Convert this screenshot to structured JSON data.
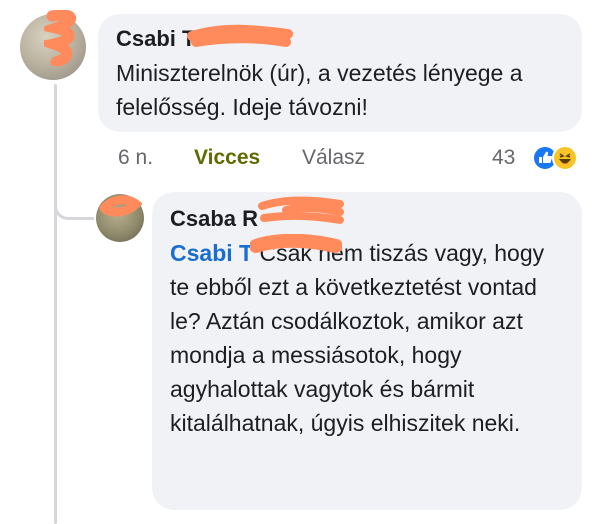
{
  "comment": {
    "author": "Csabi T",
    "text": "Miniszterelnök (úr), a vezetés lényege a felelősség. Ideje távozni!",
    "time": "6 n.",
    "reaction_label": "Vicces",
    "reply_label": "Válasz",
    "reaction_count": "43",
    "reaction_icons": [
      "like-icon",
      "haha-icon"
    ]
  },
  "reply": {
    "author": "Csaba R",
    "mention": "Csabi T",
    "text": "Csak nem tiszás vagy, hogy te ebből ezt a következtetést vontad le? Aztán csodálkoztok, amikor azt mondja a messiásotok, hogy agyhalottak vagytok és bármit kitalálhatnak, úgyis elhiszitek neki."
  },
  "colors": {
    "bubble": "#f0f2f5",
    "mention": "#1a6dd1",
    "reaction_label": "#5f6a00",
    "redaction": "#ff8a5c"
  }
}
